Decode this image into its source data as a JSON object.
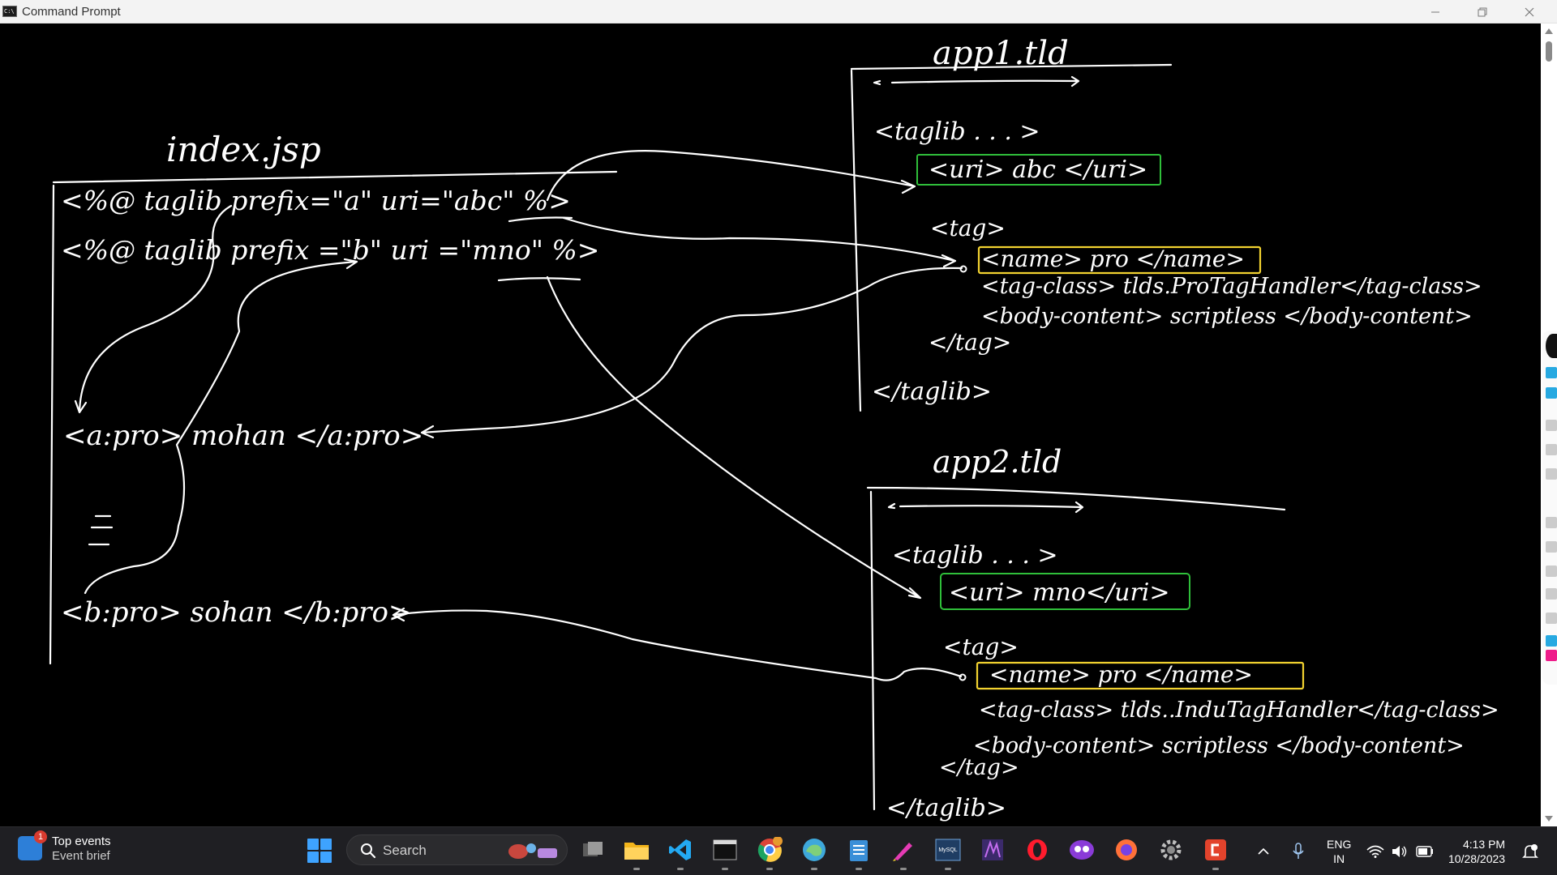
{
  "window": {
    "title": "Command Prompt",
    "controls": [
      "minimize",
      "restore",
      "close"
    ]
  },
  "drawing": {
    "index_title": "index.jsp",
    "index_lines": [
      "<%@ taglib prefix=\"a\"   uri=\"abc\"  %>",
      "<%@ taglib   prefix =\"b\"   uri =\"mno\"  %>"
    ],
    "usage_a": "<a:pro> mohan </a:pro>",
    "usage_b": "<b:pro> sohan </b:pro>",
    "app1": {
      "title": "app1.tld",
      "taglib_open": "<taglib  . . .  >",
      "uri": "<uri> abc </uri>",
      "tag_open": "<tag>",
      "name": "<name> pro </name>",
      "tag_class": "<tag-class> tlds.ProTagHandler</tag-class>",
      "body_content": "<body-content> scriptless </body-content>",
      "tag_close": "</tag>",
      "taglib_close": "</taglib>"
    },
    "app2": {
      "title": "app2.tld",
      "taglib_open": "<taglib  . . .  >",
      "uri": "<uri> mno</uri>",
      "tag_open": "<tag>",
      "name": "<name> pro </name>",
      "tag_class": "<tag-class> tlds..InduTagHandler</tag-class>",
      "body_content": "<body-content> scriptless </body-content>",
      "tag_close": "</tag>",
      "taglib_close": "</taglib>"
    },
    "colors": {
      "ink": "#ffffff",
      "uri_highlight": "#2fbf3a",
      "name_highlight": "#f2d230"
    }
  },
  "taskbar": {
    "widget_title": "Top events",
    "widget_subtitle": "Event brief",
    "widget_badge": "1",
    "search_placeholder": "Search",
    "apps": [
      "task-view-icon",
      "file-explorer-icon",
      "vscode-icon",
      "terminal-icon",
      "chrome-icon",
      "edge-icon",
      "notepad-icon",
      "pen-app-icon",
      "mysql-icon",
      "app-icon",
      "opera-icon",
      "app-icon",
      "firefox-icon",
      "settings-icon",
      "app-icon"
    ],
    "chrome_badge": "11",
    "language": "ENG",
    "region": "IN",
    "time": "4:13 PM",
    "date": "10/28/2023"
  }
}
